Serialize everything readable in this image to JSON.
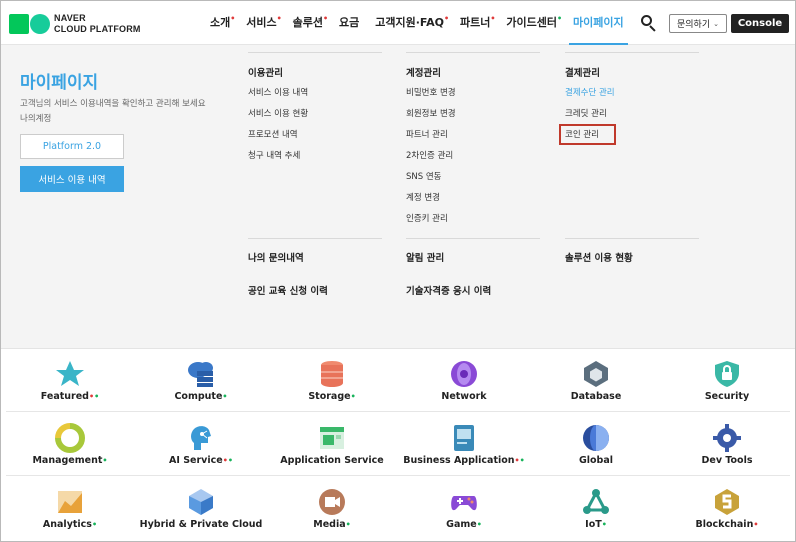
{
  "logo": {
    "line1": "NAVER",
    "line2": "CLOUD PLATFORM"
  },
  "nav": [
    {
      "label": "소개",
      "dot": "red"
    },
    {
      "label": "서비스",
      "dot": "red"
    },
    {
      "label": "솔루션",
      "dot": "red"
    },
    {
      "label": "요금",
      "dot": ""
    },
    {
      "label": "고객지원·FAQ",
      "dot": "red"
    },
    {
      "label": "파트너",
      "dot": "red"
    },
    {
      "label": "가이드센터",
      "dot": "green"
    },
    {
      "label": "마이페이지",
      "dot": "",
      "active": true
    }
  ],
  "header": {
    "inquiry_label": "문의하기",
    "console_label": "Console"
  },
  "mypage": {
    "title": "마이페이지",
    "desc_line1": "고객님의 서비스 이용내역을 확인하고 관리해 보세요",
    "desc_line2": "나의계정",
    "platform_label": "Platform 2.0",
    "history_label": "서비스 이용 내역"
  },
  "menu": {
    "usage": {
      "head": "이용관리",
      "links": [
        "서비스 이용 내역",
        "서비스 이용 현황",
        "프로모션 내역",
        "청구 내역 추세"
      ]
    },
    "account": {
      "head": "계정관리",
      "links": [
        "비밀번호 변경",
        "회원정보 변경",
        "파트너 관리",
        "2차인증 관리",
        "SNS 연동",
        "계정 변경",
        "인증키 관리"
      ]
    },
    "payment": {
      "head": "결제관리",
      "links": [
        "결제수단 관리",
        "크레딧 관리",
        "코인 관리"
      ]
    },
    "inquiries": "나의 문의내역",
    "education": "공인 교육 신청 이력",
    "notification": "알림 관리",
    "certification": "기술자격증 응시 이력",
    "solution_usage": "솔루션 이용 현황"
  },
  "products": [
    {
      "label": "Featured",
      "marks": [
        {
          "t": "•",
          "c": "r"
        },
        {
          "t": "•",
          "c": "g"
        }
      ],
      "icon": "star-icon",
      "color": "#3ab5c8"
    },
    {
      "label": "Compute",
      "marks": [
        {
          "t": "•",
          "c": "g"
        }
      ],
      "icon": "server-icon",
      "color": "#3a78c8"
    },
    {
      "label": "Storage",
      "marks": [
        {
          "t": "•",
          "c": "g"
        }
      ],
      "icon": "storage-icon",
      "color": "#e8735a"
    },
    {
      "label": "Network",
      "marks": [],
      "icon": "network-icon",
      "color": "#8a4ad6"
    },
    {
      "label": "Database",
      "marks": [],
      "icon": "database-icon",
      "color": "#5b6e7e"
    },
    {
      "label": "Security",
      "marks": [],
      "icon": "lock-shield-icon",
      "color": "#3ab8a6"
    },
    {
      "label": "Management",
      "marks": [
        {
          "t": "•",
          "c": "g"
        }
      ],
      "icon": "management-icon",
      "color": "#a8c83a"
    },
    {
      "label": "AI Service",
      "marks": [
        {
          "t": "•",
          "c": "r"
        },
        {
          "t": "•",
          "c": "g"
        }
      ],
      "icon": "ai-head-icon",
      "color": "#3a9ad6"
    },
    {
      "label": "Application Service",
      "marks": [],
      "icon": "app-window-icon",
      "color": "#3ab86a"
    },
    {
      "label": "Business Application",
      "marks": [
        {
          "t": "•",
          "c": "r"
        },
        {
          "t": "•",
          "c": "g"
        }
      ],
      "icon": "book-icon",
      "color": "#3a8ab8"
    },
    {
      "label": "Global",
      "marks": [],
      "icon": "globe-icon",
      "color": "#2a4e9e"
    },
    {
      "label": "Dev Tools",
      "marks": [],
      "icon": "gear-icon",
      "color": "#3a5aa8"
    },
    {
      "label": "Analytics",
      "marks": [
        {
          "t": "•",
          "c": "g"
        }
      ],
      "icon": "analytics-icon",
      "color": "#e8a23a"
    },
    {
      "label": "Hybrid & Private Cloud",
      "marks": [],
      "icon": "cube-icon",
      "color": "#3a7ac8"
    },
    {
      "label": "Media",
      "marks": [
        {
          "t": "•",
          "c": "g"
        }
      ],
      "icon": "media-icon",
      "color": "#b87a5a"
    },
    {
      "label": "Game",
      "marks": [
        {
          "t": "•",
          "c": "g"
        }
      ],
      "icon": "gamepad-icon",
      "color": "#8a4ad6"
    },
    {
      "label": "IoT",
      "marks": [
        {
          "t": "•",
          "c": "g"
        }
      ],
      "icon": "iot-icon",
      "color": "#2a9a8a"
    },
    {
      "label": "Blockchain",
      "marks": [
        {
          "t": "•",
          "c": "r"
        }
      ],
      "icon": "blockchain-icon",
      "color": "#c8a23a"
    }
  ],
  "colors": {
    "accent": "#3aa3e2",
    "dark_button": "#222222",
    "highlight": "#c0392b",
    "red_dot": "#e03a3a",
    "green_dot": "#17b35b"
  }
}
